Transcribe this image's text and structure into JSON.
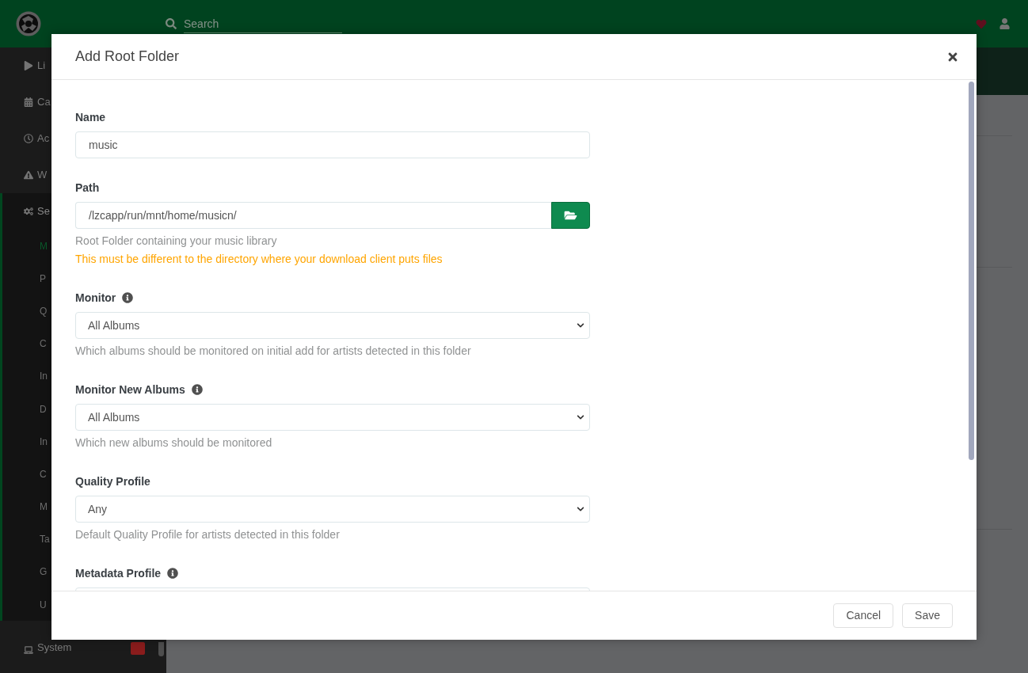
{
  "header": {
    "search": {
      "placeholder": "Search"
    }
  },
  "sidebar": {
    "items": [
      {
        "label": "Li",
        "selected": false
      },
      {
        "label": "Ca",
        "selected": false
      },
      {
        "label": "Ac",
        "selected": false
      },
      {
        "label": "W",
        "selected": false
      },
      {
        "label": "Se",
        "selected": true,
        "children": [
          {
            "label": "M",
            "selected": true
          },
          {
            "label": "P",
            "selected": false
          },
          {
            "label": "Q",
            "selected": false
          },
          {
            "label": "C",
            "selected": false
          },
          {
            "label": "In",
            "selected": false
          },
          {
            "label": "D",
            "selected": false
          },
          {
            "label": "In",
            "selected": false
          },
          {
            "label": "C",
            "selected": false
          },
          {
            "label": "M",
            "selected": false
          },
          {
            "label": "Ta",
            "selected": false
          },
          {
            "label": "G",
            "selected": false
          },
          {
            "label": "U",
            "selected": false
          }
        ]
      },
      {
        "label": "System",
        "selected": false,
        "badge": true
      }
    ]
  },
  "modal": {
    "title": "Add Root Folder",
    "fields": [
      {
        "kind": "text",
        "label": "Name",
        "info": false,
        "value": "music"
      },
      {
        "kind": "path",
        "label": "Path",
        "info": false,
        "value": "/lzcapp/run/mnt/home/musicn/",
        "help": [
          {
            "kind": "hint",
            "text": "Root Folder containing your music library"
          },
          {
            "kind": "warning",
            "text": "This must be different to the directory where your download client puts files"
          }
        ]
      },
      {
        "kind": "select",
        "label": "Monitor",
        "info": true,
        "value": "All Albums",
        "help": [
          {
            "kind": "hint",
            "text": "Which albums should be monitored on initial add for artists detected in this folder"
          }
        ]
      },
      {
        "kind": "select",
        "label": "Monitor New Albums",
        "info": true,
        "value": "All Albums",
        "help": [
          {
            "kind": "hint",
            "text": "Which new albums should be monitored"
          }
        ]
      },
      {
        "kind": "select",
        "label": "Quality Profile",
        "info": false,
        "value": "Any",
        "help": [
          {
            "kind": "hint",
            "text": "Default Quality Profile for artists detected in this folder"
          }
        ]
      },
      {
        "kind": "select",
        "label": "Metadata Profile",
        "info": true
      }
    ],
    "buttons": [
      "Cancel",
      "Save"
    ]
  }
}
